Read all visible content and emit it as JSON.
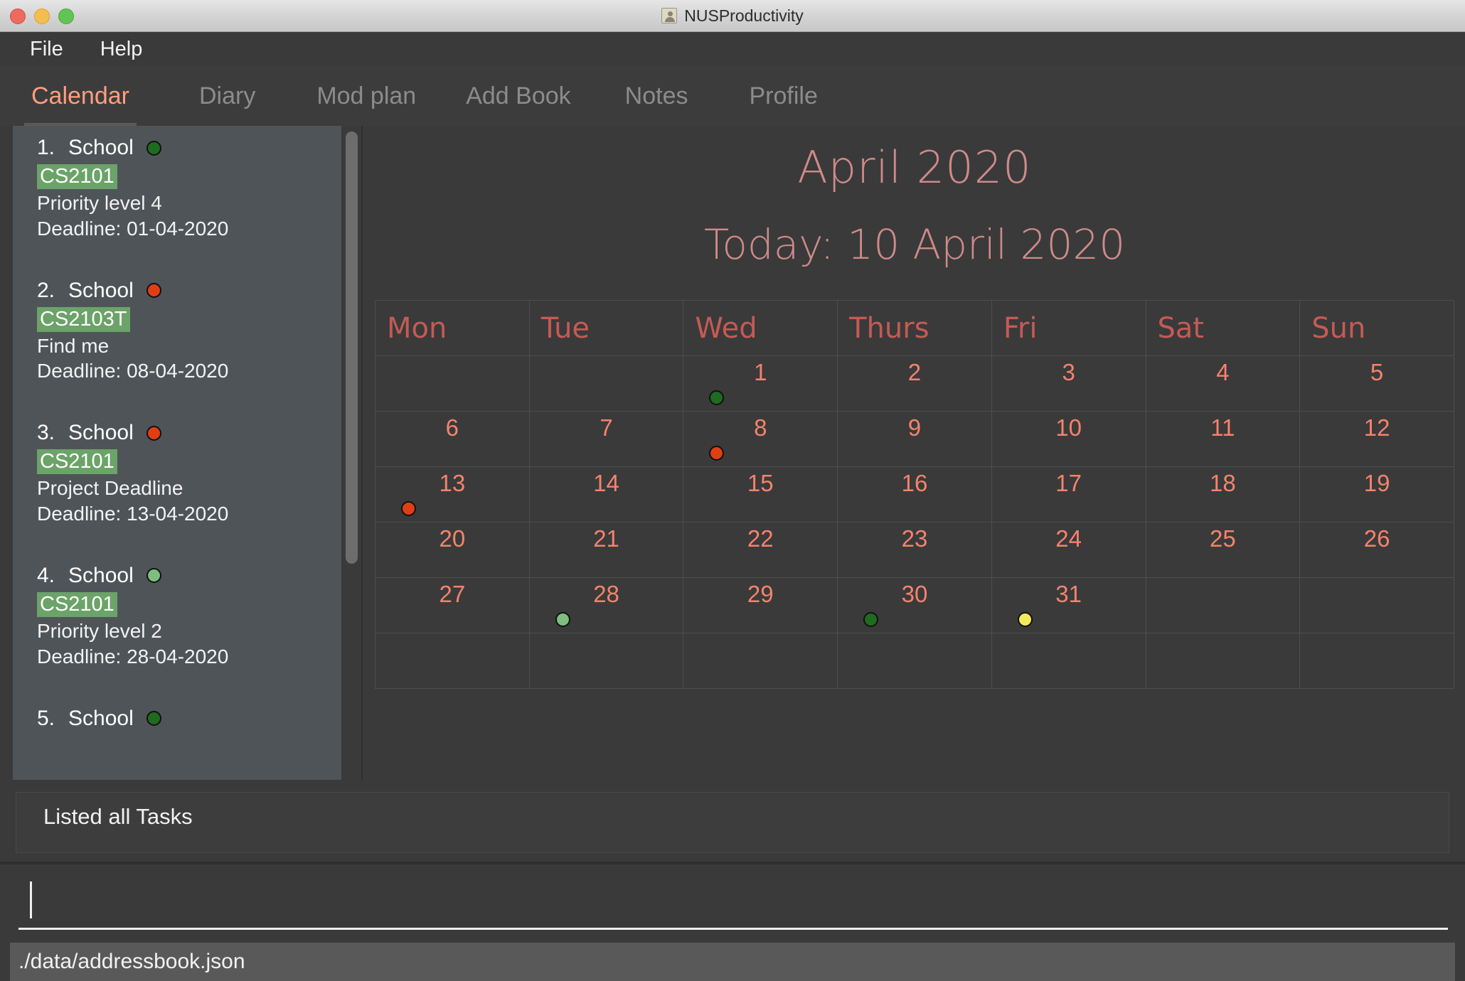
{
  "window": {
    "title": "NUSProductivity",
    "app_icon": "person-icon",
    "traffic_lights": [
      "close-button",
      "minimize-button",
      "maximize-button"
    ]
  },
  "menubar": {
    "items": [
      "File",
      "Help"
    ]
  },
  "tabs": [
    {
      "label": "Calendar",
      "active": true
    },
    {
      "label": "Diary",
      "active": false
    },
    {
      "label": "Mod plan",
      "active": false
    },
    {
      "label": "Add Book",
      "active": false
    },
    {
      "label": "Notes",
      "active": false
    },
    {
      "label": "Profile",
      "active": false
    }
  ],
  "colors": {
    "accent_tab": "#ff9e80",
    "calendar_heading": "#cf8a8a",
    "weekday_header": "#c55a55",
    "day_number": "#f4836d",
    "tag_green": "#6ba368",
    "dot_dark_green": "#1f6b1f",
    "dot_light_green": "#7fbd7f",
    "dot_red": "#e03e15",
    "dot_yellow": "#f2ea5a",
    "sidebar_bg": "#4f5458"
  },
  "sidebar": {
    "tasks": [
      {
        "index": "1.",
        "type": "School",
        "priority_color": "#1f6b1f",
        "tag": "CS2101",
        "description": "Priority level 4",
        "deadline": "Deadline: 01-04-2020"
      },
      {
        "index": "2.",
        "type": "School",
        "priority_color": "#e03e15",
        "tag": "CS2103T",
        "description": "Find me",
        "deadline": "Deadline: 08-04-2020"
      },
      {
        "index": "3.",
        "type": "School",
        "priority_color": "#e03e15",
        "tag": "CS2101",
        "description": "Project Deadline",
        "deadline": "Deadline: 13-04-2020"
      },
      {
        "index": "4.",
        "type": "School",
        "priority_color": "#7fbd7f",
        "tag": "CS2101",
        "description": "Priority level 2",
        "deadline": "Deadline: 28-04-2020"
      },
      {
        "index": "5.",
        "type": "School",
        "priority_color": "#1f6b1f",
        "tag": "",
        "description": "",
        "deadline": ""
      }
    ]
  },
  "calendar": {
    "month_title": "April 2020",
    "today_label": "Today: 10 April 2020",
    "weekdays": [
      "Mon",
      "Tue",
      "Wed",
      "Thurs",
      "Fri",
      "Sat",
      "Sun"
    ],
    "weeks": [
      [
        {
          "day": ""
        },
        {
          "day": ""
        },
        {
          "day": "1",
          "dot": "#1f6b1f"
        },
        {
          "day": "2"
        },
        {
          "day": "3"
        },
        {
          "day": "4"
        },
        {
          "day": "5"
        }
      ],
      [
        {
          "day": "6"
        },
        {
          "day": "7"
        },
        {
          "day": "8",
          "dot": "#e03e15"
        },
        {
          "day": "9"
        },
        {
          "day": "10"
        },
        {
          "day": "11"
        },
        {
          "day": "12"
        }
      ],
      [
        {
          "day": "13",
          "dot": "#e03e15"
        },
        {
          "day": "14"
        },
        {
          "day": "15"
        },
        {
          "day": "16"
        },
        {
          "day": "17"
        },
        {
          "day": "18"
        },
        {
          "day": "19"
        }
      ],
      [
        {
          "day": "20"
        },
        {
          "day": "21"
        },
        {
          "day": "22"
        },
        {
          "day": "23"
        },
        {
          "day": "24"
        },
        {
          "day": "25"
        },
        {
          "day": "26"
        }
      ],
      [
        {
          "day": "27"
        },
        {
          "day": "28",
          "dot": "#7fbd7f"
        },
        {
          "day": "29"
        },
        {
          "day": "30",
          "dot": "#1f6b1f"
        },
        {
          "day": "31",
          "dot": "#f2ea5a"
        },
        {
          "day": ""
        },
        {
          "day": ""
        }
      ],
      [
        {
          "day": ""
        },
        {
          "day": ""
        },
        {
          "day": ""
        },
        {
          "day": ""
        },
        {
          "day": ""
        },
        {
          "day": ""
        },
        {
          "day": ""
        }
      ]
    ]
  },
  "result_box": {
    "message": "Listed all Tasks"
  },
  "command_input": {
    "value": "",
    "placeholder": ""
  },
  "status_bar": {
    "file_path": "./data/addressbook.json"
  }
}
